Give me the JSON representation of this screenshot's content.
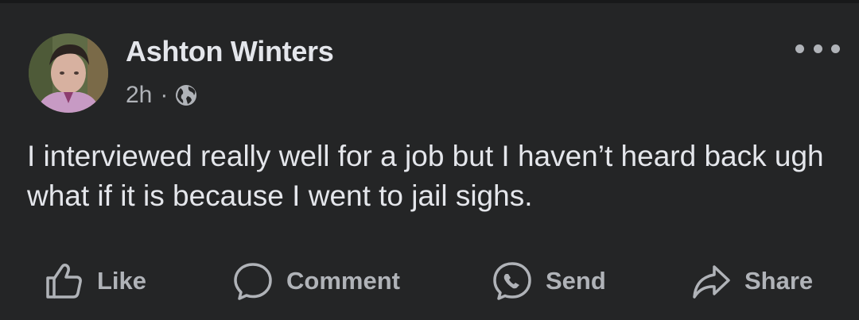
{
  "post": {
    "author_name": "Ashton Winters",
    "time": "2h",
    "separator": "·",
    "privacy_icon": "globe-icon",
    "more_icon": "more-options-icon",
    "text": "I interviewed really well for a job but I haven’t heard back ugh what if it is because I went to jail sighs."
  },
  "actions": {
    "like_label": "Like",
    "comment_label": "Comment",
    "send_label": "Send",
    "share_label": "Share"
  },
  "colors": {
    "background": "#242526",
    "primary_text": "#e4e6eb",
    "secondary_text": "#b0b3b8"
  }
}
